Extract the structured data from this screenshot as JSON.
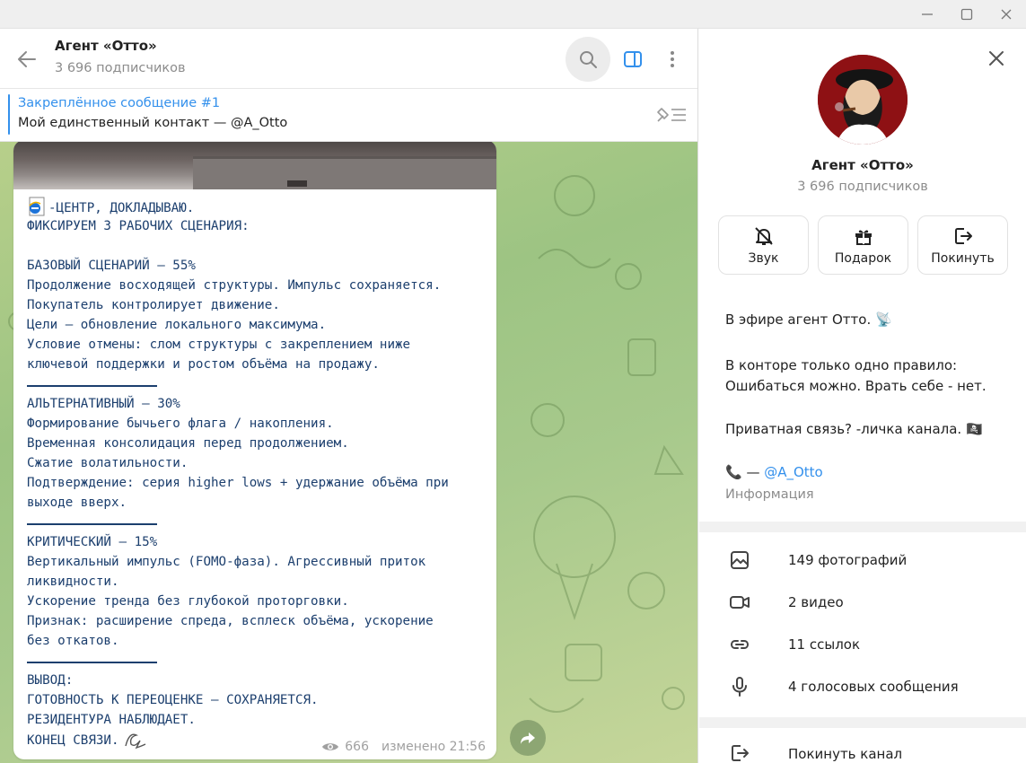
{
  "window": {
    "minimize_icon": "minimize-icon",
    "maximize_icon": "maximize-icon",
    "close_icon": "close-icon"
  },
  "header": {
    "title": "Агент «Отто»",
    "subtitle": "3 696 подписчиков"
  },
  "pinned": {
    "title": "Закреплённое сообщение #1",
    "text": "Мой единственный контакт — @A_Otto"
  },
  "message": {
    "lines": [
      "-ЦЕНТР, ДОКЛАДЫВАЮ.",
      "ФИКСИРУЕМ 3 РАБОЧИХ СЦЕНАРИЯ:",
      "",
      "БАЗОВЫЙ СЦЕНАРИЙ — 55%",
      "Продолжение восходящей структуры. Импульс сохраняется.",
      "Покупатель контролирует движение.",
      "Цели — обновление локального максимума.",
      "Условие отмены: слом структуры с закреплением ниже",
      "ключевой поддержки и ростом объёма на продажу.",
      "АЛЬТЕРНАТИВНЫЙ — 30%",
      "Формирование бычьего флага / накопления.",
      "Временная консолидация перед продолжением.",
      "Сжатие волатильности.",
      "Подтверждение: серия higher lows + удержание объёма при",
      "выходе вверх.",
      "КРИТИЧЕСКИЙ — 15%",
      "Вертикальный импульс (FOMO-фаза). Агрессивный приток",
      "ликвидности.",
      "Ускорение тренда без глубокой проторговки.",
      "Признак: расширение спреда, всплеск объёма, ускорение",
      "без откатов.",
      "ВЫВОД:",
      "ГОТОВНОСТЬ К ПЕРЕОЦЕНКЕ — СОХРАНЯЕТСЯ.",
      "РЕЗИДЕНТУРА НАБЛЮДАЕТ.",
      "КОНЕЦ СВЯЗИ."
    ],
    "views": "666",
    "edited": "изменено 21:56"
  },
  "profile": {
    "name": "Агент «Отто»",
    "subscribers": "3 696 подписчиков",
    "actions": [
      {
        "label": "Звук",
        "icon": "bell-off-icon"
      },
      {
        "label": "Подарок",
        "icon": "gift-icon"
      },
      {
        "label": "Покинуть",
        "icon": "leave-icon"
      }
    ],
    "about": {
      "line1": "В эфире агент Отто. 📡",
      "line2": "В конторе только одно правило:",
      "line3": "Ошибаться можно. Врать себе - нет.",
      "line4": "Приватная связь? -личка канала. 🏴‍☠️",
      "phone_prefix": "📞 — ",
      "contact": "@A_Otto",
      "info_label": "Информация"
    },
    "media": [
      {
        "label": "149 фотографий",
        "icon": "photo-icon"
      },
      {
        "label": "2 видео",
        "icon": "video-icon"
      },
      {
        "label": "11 ссылок",
        "icon": "link-icon"
      },
      {
        "label": "4 голосовых сообщения",
        "icon": "microphone-icon"
      }
    ],
    "leave_label": "Покинуть канал"
  },
  "colors": {
    "accent": "#3390ec",
    "message_text": "#1c3f6e",
    "chat_background": "#a7c98c"
  }
}
